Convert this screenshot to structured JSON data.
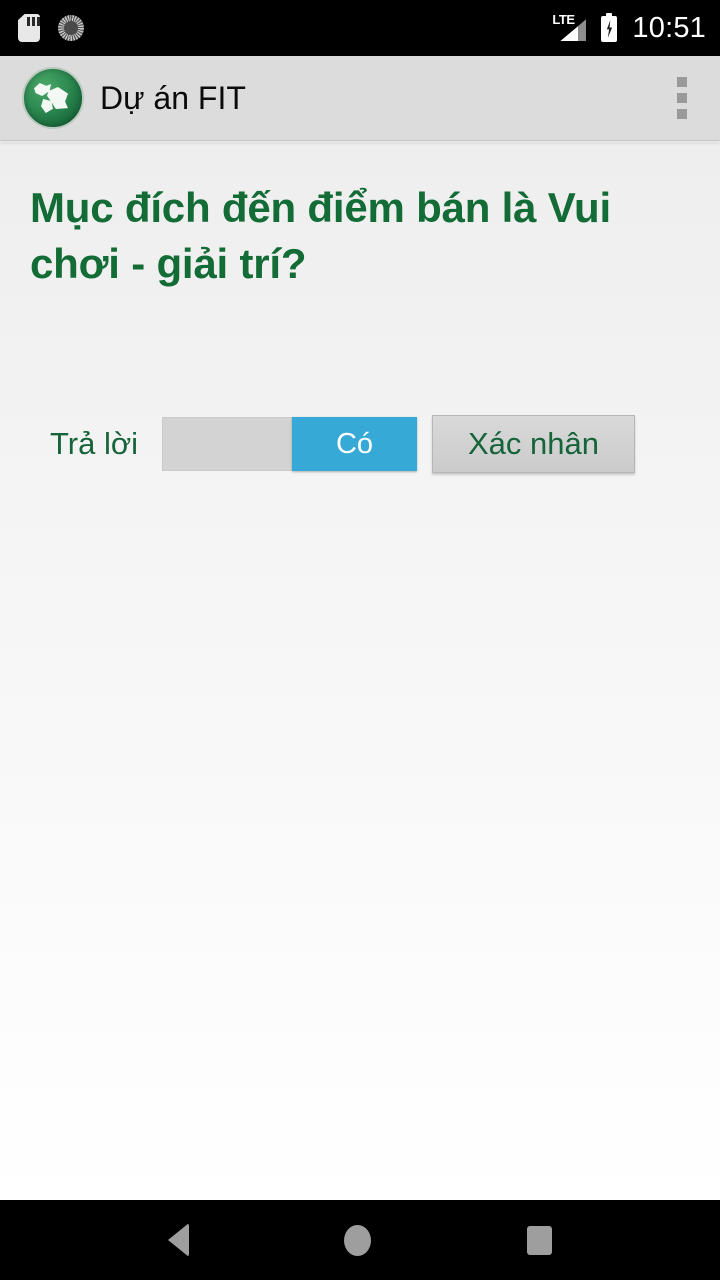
{
  "status_bar": {
    "icons": [
      {
        "name": "sd-card-icon"
      },
      {
        "name": "sync-spinner-icon"
      }
    ],
    "network_label": "LTE",
    "signal_icon": "signal-bars-icon",
    "battery_icon": "battery-charging-icon",
    "time": "10:51"
  },
  "app_bar": {
    "logo_icon": "app-globe-logo-icon",
    "title": "Dự án FIT",
    "overflow_icon": "overflow-menu-icon"
  },
  "content": {
    "question": "Mục đích đến điểm bán là Vui chơi - giải trí?",
    "answer_label": "Trả lời",
    "switch": {
      "state_label": "Có",
      "checked": "true"
    },
    "confirm_label": "Xác nhân"
  },
  "nav_bar": {
    "back": "back-icon",
    "home": "home-icon",
    "recents": "recents-icon"
  },
  "colors": {
    "brand_green": "#136b36",
    "switch_thumb_blue": "#37a9d6",
    "app_bar_bg": "#dcdcdc",
    "status_bar_bg": "#000000"
  }
}
